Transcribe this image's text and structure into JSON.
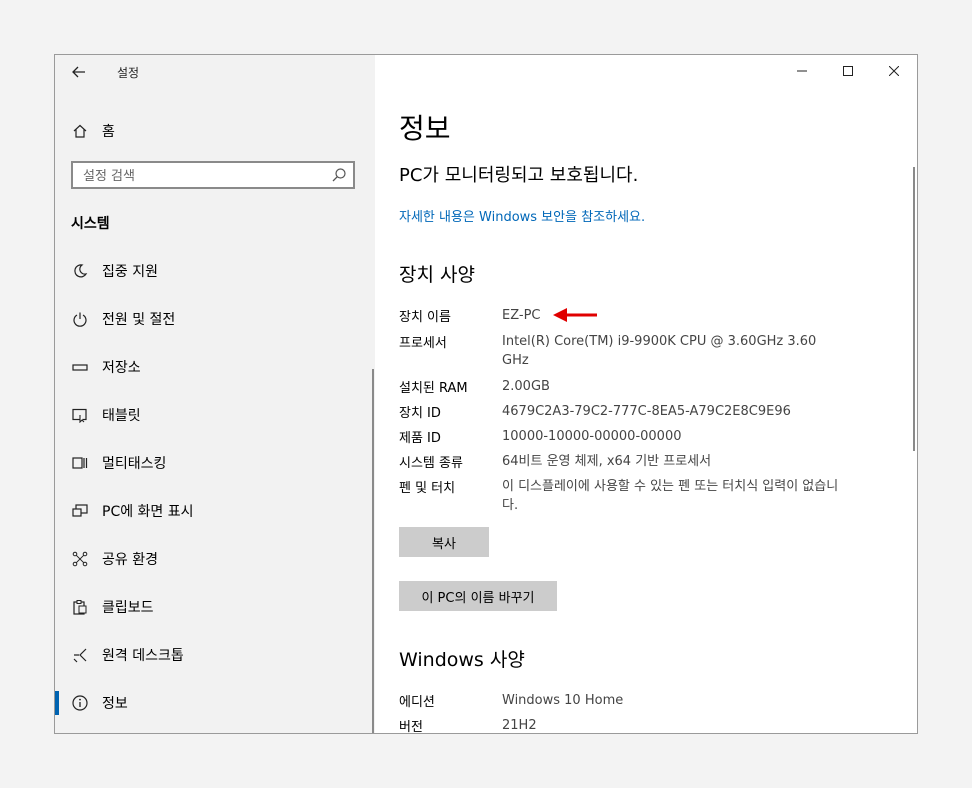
{
  "app": {
    "title": "설정"
  },
  "sidebar": {
    "home_label": "홈",
    "search_placeholder": "설정 검색",
    "section_title": "시스템",
    "items": [
      {
        "label": "집중 지원",
        "icon": "moon-icon"
      },
      {
        "label": "전원 및 절전",
        "icon": "power-icon"
      },
      {
        "label": "저장소",
        "icon": "storage-icon"
      },
      {
        "label": "태블릿",
        "icon": "tablet-icon"
      },
      {
        "label": "멀티태스킹",
        "icon": "multitasking-icon"
      },
      {
        "label": "PC에 화면 표시",
        "icon": "project-icon"
      },
      {
        "label": "공유 환경",
        "icon": "share-icon"
      },
      {
        "label": "클립보드",
        "icon": "clipboard-icon"
      },
      {
        "label": "원격 데스크톱",
        "icon": "remote-desktop-icon"
      },
      {
        "label": "정보",
        "icon": "info-icon",
        "active": true
      }
    ]
  },
  "main": {
    "title": "정보",
    "status": "PC가 모니터링되고 보호됩니다.",
    "security_link": "자세한 내용은 Windows 보안을 참조하세요.",
    "device_specs": {
      "heading": "장치 사양",
      "rows": [
        {
          "label": "장치 이름",
          "value": "EZ-PC"
        },
        {
          "label": "프로세서",
          "value": "Intel(R) Core(TM) i9-9900K CPU @ 3.60GHz   3.60 GHz"
        },
        {
          "label": "설치된 RAM",
          "value": "2.00GB"
        },
        {
          "label": "장치 ID",
          "value": "4679C2A3-79C2-777C-8EA5-A79C2E8C9E96"
        },
        {
          "label": "제품 ID",
          "value": "10000-10000-00000-00000"
        },
        {
          "label": "시스템 종류",
          "value": "64비트 운영 체제, x64 기반 프로세서"
        },
        {
          "label": "펜 및 터치",
          "value": "이 디스플레이에 사용할 수 있는 펜 또는 터치식 입력이 없습니다."
        }
      ],
      "copy_button": "복사",
      "rename_button": "이 PC의 이름 바꾸기"
    },
    "windows_specs": {
      "heading": "Windows 사양",
      "rows": [
        {
          "label": "에디션",
          "value": "Windows 10 Home"
        },
        {
          "label": "버전",
          "value": "21H2"
        }
      ]
    }
  },
  "annotation": {
    "arrow_color": "#e00000"
  },
  "colors": {
    "accent": "#0063b1",
    "link": "#0067b8",
    "button_bg": "#cccccc"
  }
}
